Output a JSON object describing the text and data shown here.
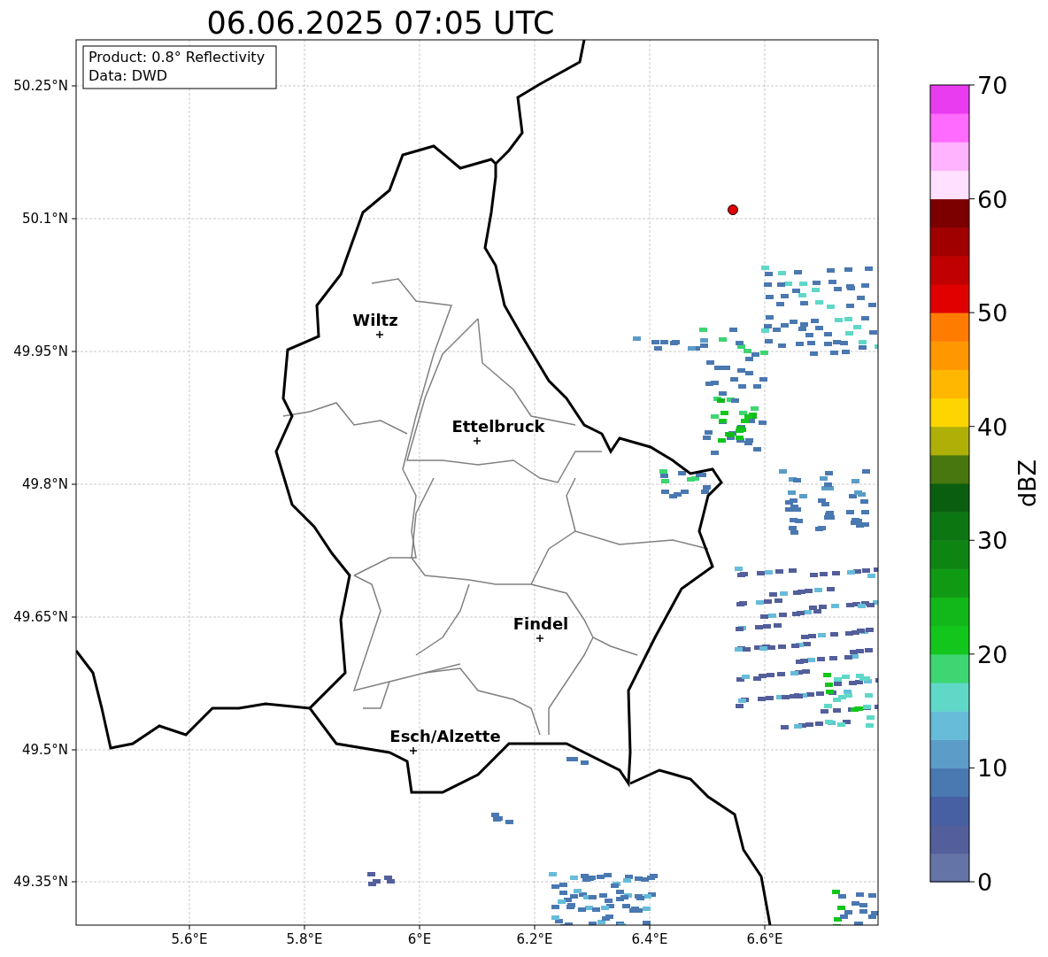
{
  "title": "06.06.2025 07:05 UTC",
  "info_box": [
    "Product: 0.8° Reflectivity",
    "Data: DWD"
  ],
  "x_ticks": [
    "5.6°E",
    "5.8°E",
    "6°E",
    "6.2°E",
    "6.4°E",
    "6.6°E"
  ],
  "y_ticks": [
    "50.25°N",
    "50.1°N",
    "49.95°N",
    "49.8°N",
    "49.65°N",
    "49.5°N",
    "49.35°N"
  ],
  "cities": [
    {
      "name": "Wiltz"
    },
    {
      "name": "Ettelbruck"
    },
    {
      "name": "Findel"
    },
    {
      "name": "Esch/Alzette"
    }
  ],
  "colorbar": {
    "label": "dBZ",
    "ticks": [
      "70",
      "60",
      "50",
      "40",
      "30",
      "20",
      "10",
      "0"
    ],
    "bands": [
      {
        "color": "#6574a6"
      },
      {
        "color": "#535f9b"
      },
      {
        "color": "#4760a3"
      },
      {
        "color": "#4a78b1"
      },
      {
        "color": "#5b9cc8"
      },
      {
        "color": "#66bcd9"
      },
      {
        "color": "#5fd8c8"
      },
      {
        "color": "#3dd672"
      },
      {
        "color": "#13c61c"
      },
      {
        "color": "#12b819"
      },
      {
        "color": "#109a14"
      },
      {
        "color": "#0e8513"
      },
      {
        "color": "#0b7612"
      },
      {
        "color": "#0a5e0f"
      },
      {
        "color": "#47770e"
      },
      {
        "color": "#afb007"
      },
      {
        "color": "#ffd500"
      },
      {
        "color": "#ffb700"
      },
      {
        "color": "#ff9800"
      },
      {
        "color": "#ff7c00"
      },
      {
        "color": "#e00000"
      },
      {
        "color": "#c00000"
      },
      {
        "color": "#a00000"
      },
      {
        "color": "#7c0000"
      },
      {
        "color": "#ffe0ff"
      },
      {
        "color": "#ffb3ff"
      },
      {
        "color": "#ff6aff"
      },
      {
        "color": "#e93cf0"
      }
    ]
  }
}
